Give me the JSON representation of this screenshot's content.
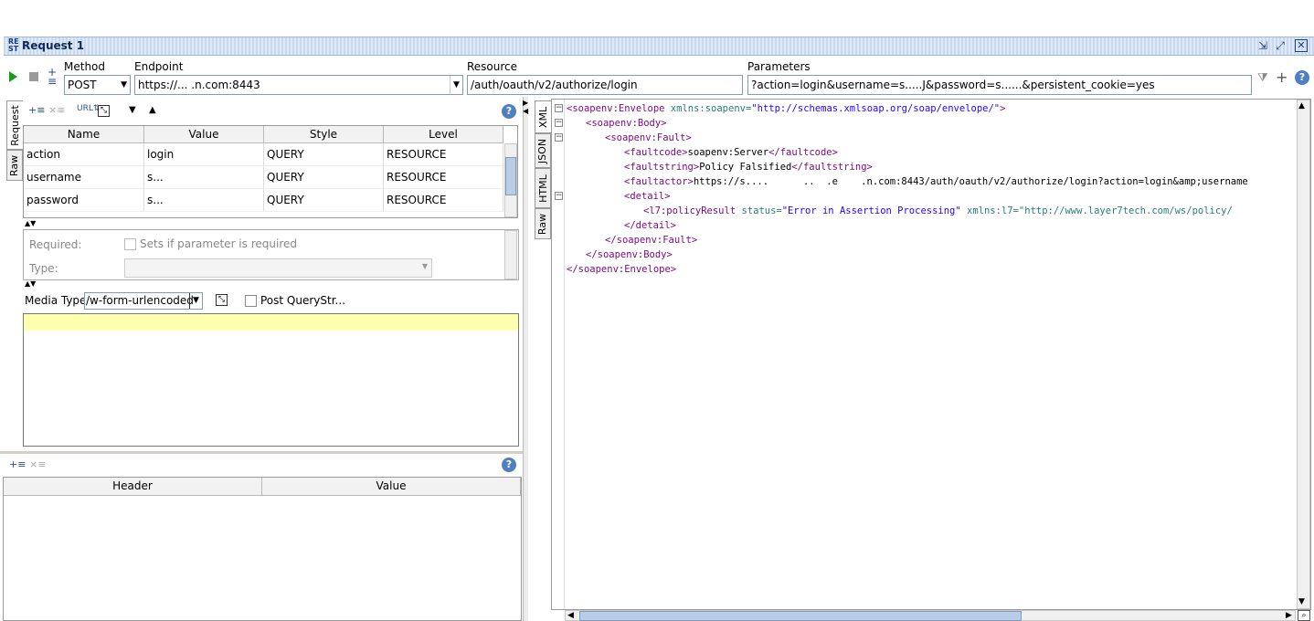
{
  "window": {
    "title": "Request 1",
    "icon_text": "RE\nST"
  },
  "toolbar": {
    "method_label": "Method",
    "method_value": "POST",
    "endpoint_label": "Endpoint",
    "endpoint_value": "https://...              .n.com:8443",
    "resource_label": "Resource",
    "resource_value": "/auth/oauth/v2/authorize/login",
    "parameters_label": "Parameters",
    "parameters_value": "?action=login&username=s.....J&password=s......&persistent_cookie=yes"
  },
  "left_tabs": [
    "Request",
    "Raw"
  ],
  "params_table": {
    "headers": [
      "Name",
      "Value",
      "Style",
      "Level"
    ],
    "rows": [
      {
        "name": "action",
        "value": "login",
        "style": "QUERY",
        "level": "RESOURCE"
      },
      {
        "name": "username",
        "value": "s...",
        "style": "QUERY",
        "level": "RESOURCE"
      },
      {
        "name": "password",
        "value": "s...",
        "style": "QUERY",
        "level": "RESOURCE"
      }
    ]
  },
  "param_detail": {
    "required_label": "Required:",
    "required_checkbox_label": "Sets if parameter is required",
    "type_label": "Type:"
  },
  "media": {
    "label": "Media Type",
    "value": "/w-form-urlencoded",
    "post_querystring_label": "Post QueryStr..."
  },
  "headers_table": {
    "headers": [
      "Header",
      "Value"
    ]
  },
  "right_tabs": [
    "XML",
    "JSON",
    "HTML",
    "Raw"
  ],
  "xml_lines": [
    {
      "indent": 0,
      "open": "<soapenv:Envelope",
      "attr": " xmlns:soapenv=",
      "val": "\"http://schemas.xmlsoap.org/soap/envelope/\"",
      "close": ">",
      "text": ""
    },
    {
      "indent": 1,
      "open": "<soapenv:Body>",
      "attr": "",
      "val": "",
      "close": "",
      "text": ""
    },
    {
      "indent": 2,
      "open": "<soapenv:Fault>",
      "attr": "",
      "val": "",
      "close": "",
      "text": ""
    },
    {
      "indent": 3,
      "open": "<faultcode>",
      "attr": "",
      "val": "",
      "close": "</faultcode>",
      "text": "soapenv:Server"
    },
    {
      "indent": 3,
      "open": "<faultstring>",
      "attr": "",
      "val": "",
      "close": "</faultstring>",
      "text": "Policy Falsified"
    },
    {
      "indent": 3,
      "open": "<faultactor>",
      "attr": "",
      "val": "",
      "close": "",
      "text": "https://s....      ..  .e    .n.com:8443/auth/oauth/v2/authorize/login?action=login&amp;username"
    },
    {
      "indent": 3,
      "open": "<detail>",
      "attr": "",
      "val": "",
      "close": "",
      "text": ""
    },
    {
      "indent": 4,
      "open": "<l7:policyResult",
      "attr": " status=",
      "val": "\"Error in Assertion Processing\"",
      "close": "",
      "text": " xmlns:l7=\"http://www.layer7tech.com/ws/policy/"
    },
    {
      "indent": 3,
      "open": "</detail>",
      "attr": "",
      "val": "",
      "close": "",
      "text": ""
    },
    {
      "indent": 2,
      "open": "</soapenv:Fault>",
      "attr": "",
      "val": "",
      "close": "",
      "text": ""
    },
    {
      "indent": 1,
      "open": "</soapenv:Body>",
      "attr": "",
      "val": "",
      "close": "",
      "text": ""
    },
    {
      "indent": 0,
      "open": "</soapenv:Envelope>",
      "attr": "",
      "val": "",
      "close": "",
      "text": ""
    }
  ]
}
